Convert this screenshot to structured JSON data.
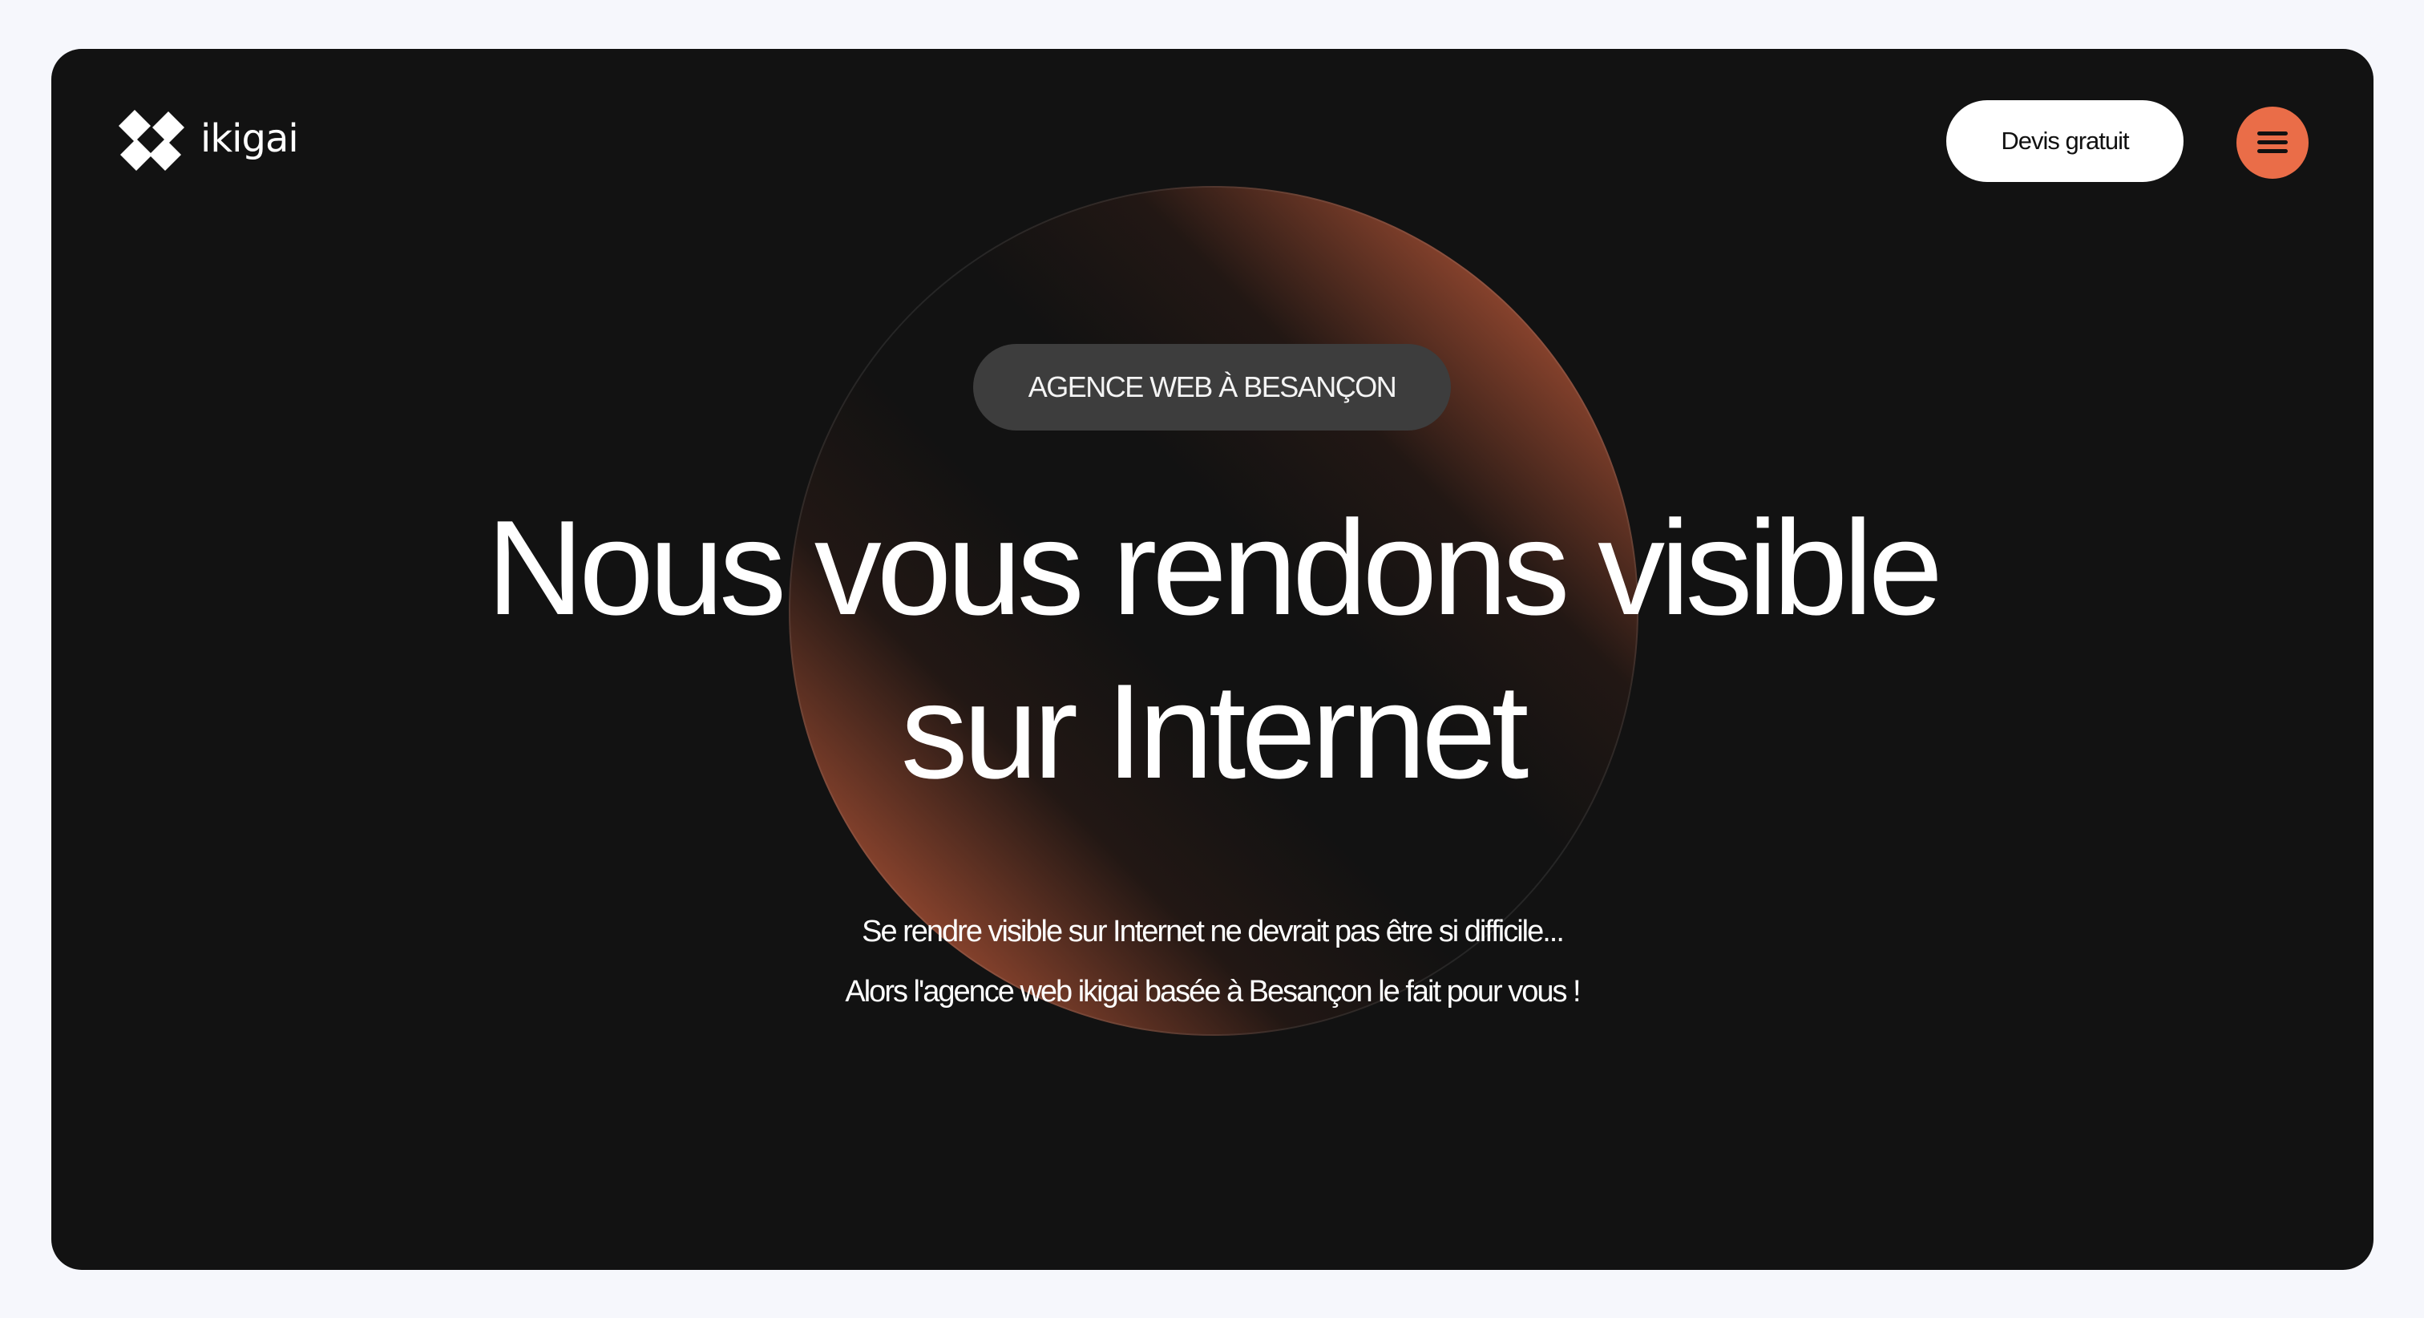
{
  "brand": {
    "name": "ikigai",
    "logo_icon": "ikigai-x-logo",
    "accent_color": "#ea6d48",
    "background_color": "#121212"
  },
  "header": {
    "cta_label": "Devis gratuit",
    "menu_icon": "hamburger-menu-icon"
  },
  "hero": {
    "badge": "AGENCE WEB À BESANÇON",
    "title_line1": "Nous vous rendons visible",
    "title_line2": "sur Internet",
    "subtitle_line1": "Se rendre visible sur Internet ne devrait pas être si difficile...",
    "subtitle_line2": "Alors l'agence web ikigai basée à Besançon le fait pour vous !"
  }
}
